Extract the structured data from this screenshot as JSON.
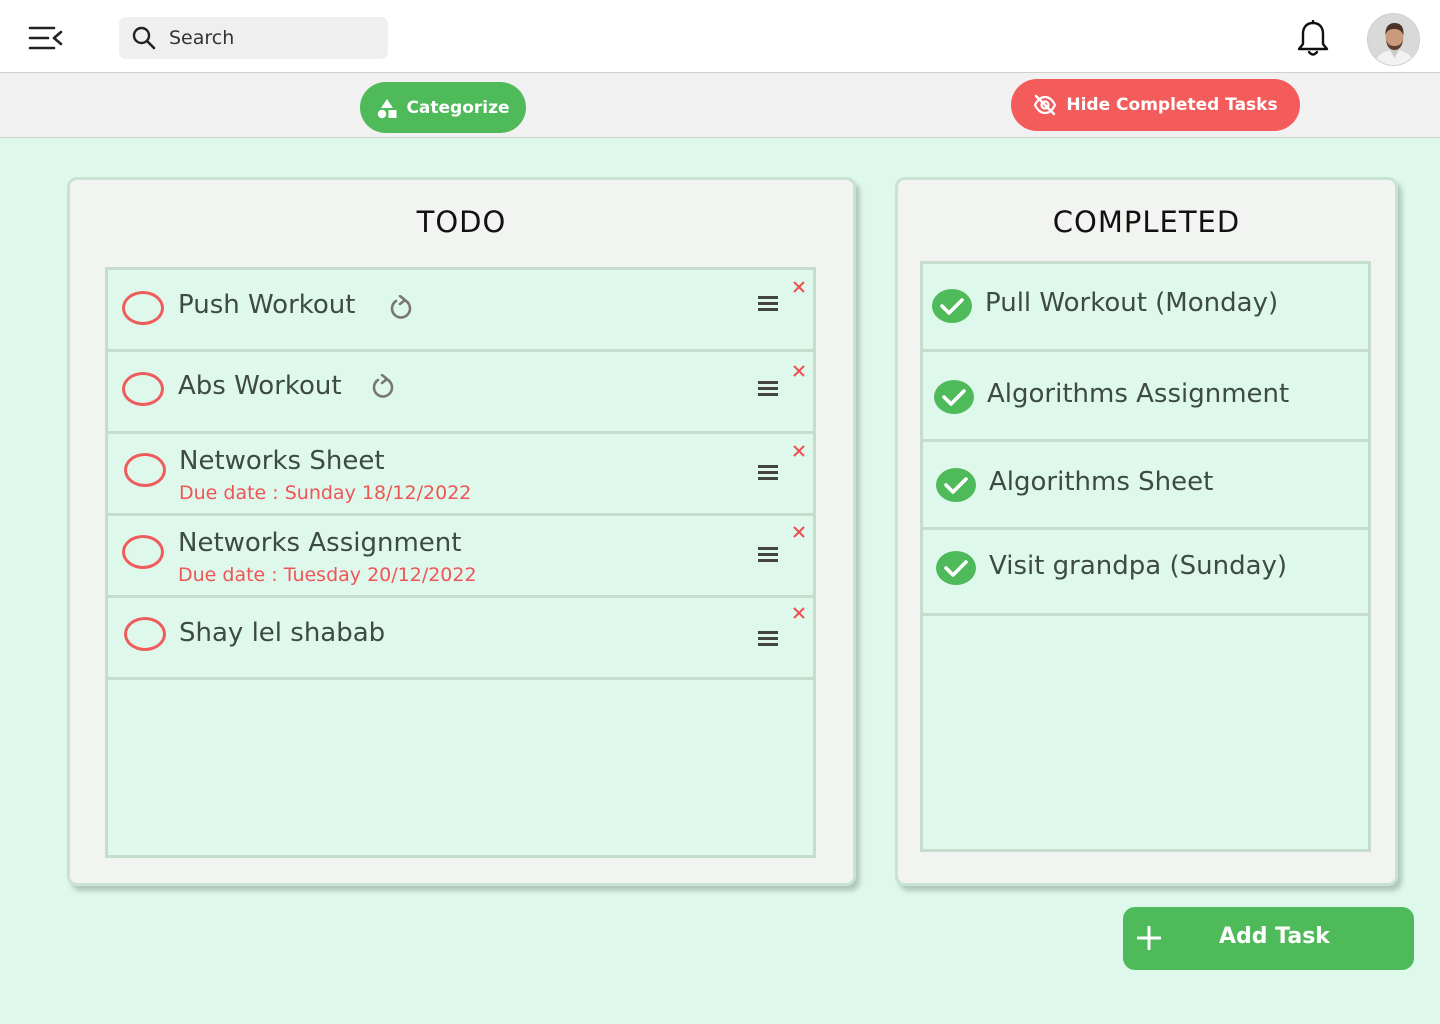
{
  "topbar": {
    "search_placeholder": "Search",
    "menu_icon": "menu-collapse-icon",
    "search_icon": "search-icon",
    "bell_icon": "bell-icon",
    "avatar": "user-avatar"
  },
  "actions": {
    "categorize_label": "Categorize",
    "categorize_icon": "shapes-icon",
    "hide_completed_label": "Hide Completed Tasks",
    "hide_icon": "eye-off-icon"
  },
  "todo": {
    "title": "TODO",
    "items": [
      {
        "title": "Push Workout",
        "due": "",
        "recurring": true
      },
      {
        "title": "Abs Workout",
        "due": "",
        "recurring": true
      },
      {
        "title": "Networks Sheet",
        "due": "Due date : Sunday 18/12/2022",
        "recurring": false
      },
      {
        "title": "Networks Assignment",
        "due": "Due date : Tuesday 20/12/2022",
        "recurring": false
      },
      {
        "title": "Shay lel shabab",
        "due": "",
        "recurring": false
      }
    ]
  },
  "completed": {
    "title": "COMPLETED",
    "items": [
      {
        "title": "Pull Workout (Monday)"
      },
      {
        "title": "Algorithms Assignment"
      },
      {
        "title": "Algorithms Sheet"
      },
      {
        "title": "Visit grandpa (Sunday)"
      }
    ]
  },
  "add_task": {
    "label": "Add Task",
    "icon": "plus-icon"
  },
  "colors": {
    "background": "#dff8ec",
    "accent_green": "#4fba5a",
    "accent_red": "#f45c5c",
    "panel": "#f2f4f1"
  }
}
